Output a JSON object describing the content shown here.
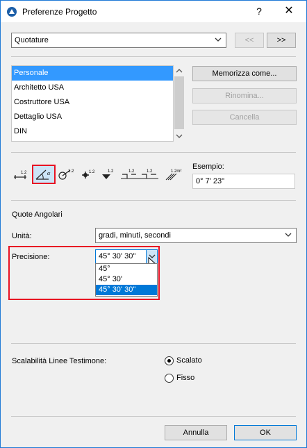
{
  "window": {
    "title": "Preferenze Progetto",
    "help": "?",
    "close": "✕"
  },
  "top": {
    "selected_category": "Quotature",
    "prev_label": "<<",
    "next_label": ">>"
  },
  "list": {
    "items": [
      "Personale",
      "Architetto USA",
      "Costruttore USA",
      "Dettaglio USA",
      "DIN"
    ],
    "selected_index": 0
  },
  "side_buttons": {
    "save_as": "Memorizza come...",
    "rename": "Rinomina...",
    "delete": "Cancella"
  },
  "toolbar": {
    "icons": [
      "linear-dimension-icon",
      "angular-dimension-icon",
      "radial-dimension-icon",
      "level-dimension-icon",
      "elevation-dimension-icon",
      "door-window-dimension-icon",
      "area-dimension-icon"
    ],
    "selected": "angular-dimension-icon"
  },
  "example": {
    "label": "Esempio:",
    "value": "0° 7' 23\""
  },
  "section_title": "Quote Angolari",
  "units": {
    "label": "Unità:",
    "value": "gradi, minuti, secondi"
  },
  "precision": {
    "label": "Precisione:",
    "value": "45° 30' 30\"",
    "options": [
      "45°",
      "45° 30'",
      "45° 30' 30\""
    ],
    "selected_index": 2
  },
  "witness": {
    "label": "Scalabilità Linee Testimone:",
    "opt_scaled": "Scalato",
    "opt_fixed": "Fisso",
    "selected": "Scalato"
  },
  "footer": {
    "cancel": "Annulla",
    "ok": "OK"
  },
  "colors": {
    "accent": "#0078d7",
    "selection": "#3399ff",
    "highlight_border": "#e81123"
  }
}
